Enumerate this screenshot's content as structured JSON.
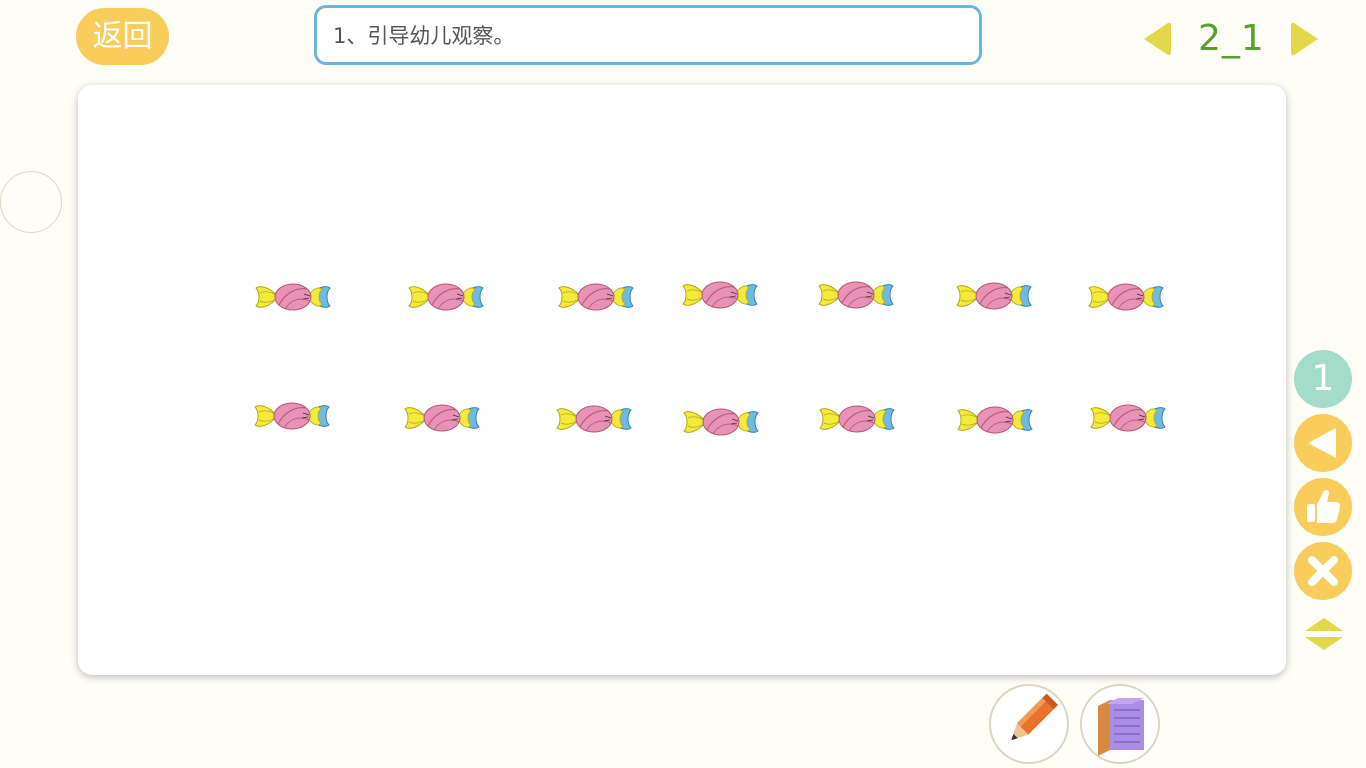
{
  "header": {
    "back_label": "返回",
    "instruction": "1、引导幼儿观察。",
    "page_number": "2_1"
  },
  "toolbar": {
    "number_label": "1",
    "tools": [
      "previous-icon",
      "thumbs-up-icon",
      "close-icon",
      "collapse-icon"
    ]
  },
  "board": {
    "rows": 2,
    "candies_per_row": 7,
    "item_icon": "candy-icon"
  },
  "bottom_tools": [
    "pencil-icon",
    "notebook-icon"
  ],
  "colors": {
    "accent_yellow": "#f8cd5c",
    "arrow_yellow": "#e2d84a",
    "page_number_green": "#5aa02c",
    "instruction_border": "#6ab5de",
    "number_button": "#a3dcc9",
    "background": "#fefdf6"
  }
}
